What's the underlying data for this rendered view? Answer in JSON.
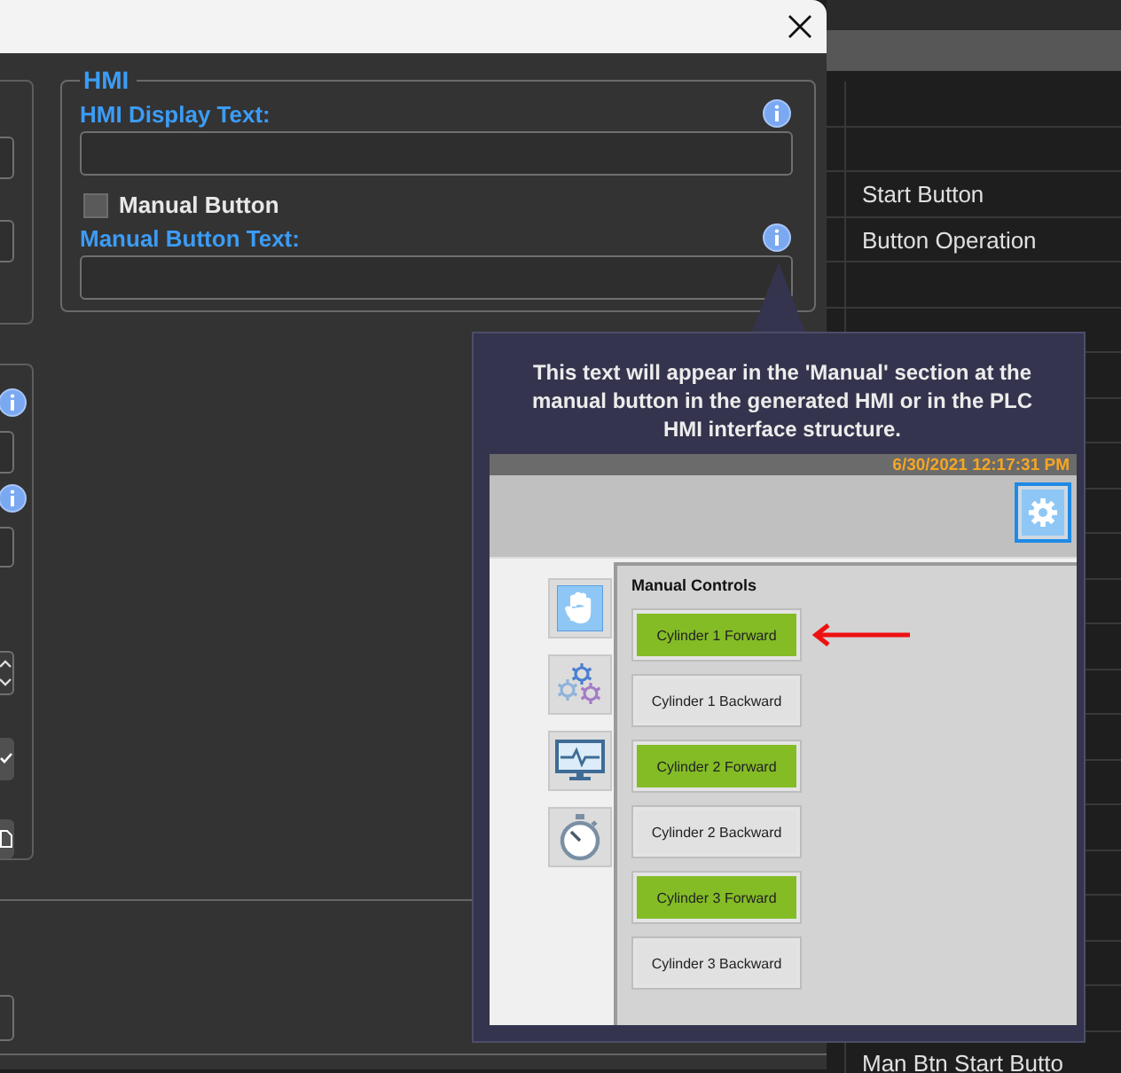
{
  "background_list": {
    "rows": [
      "Start Button",
      "Button Operation"
    ],
    "last_row": "Man Btn Start Butto"
  },
  "hmi_group": {
    "title": "HMI",
    "display_text": {
      "label": "HMI Display Text:"
    },
    "manual_button": {
      "label": "Manual Button",
      "checked": false
    },
    "manual_button_text": {
      "label": "Manual Button Text:"
    }
  },
  "tooltip": {
    "text": "This text will appear in the 'Manual' section at the manual button in the generated HMI or in the PLC HMI interface structure.",
    "preview": {
      "timestamp": "6/30/2021 12:17:31 PM",
      "panel_title": "Manual Controls",
      "buttons": [
        {
          "label": "Cylinder 1 Forward",
          "color": "#84bc26",
          "highlighted": true
        },
        {
          "label": "Cylinder 1 Backward",
          "color": "#e1e1e1",
          "highlighted": false
        },
        {
          "label": "Cylinder 2 Forward",
          "color": "#84bc26",
          "highlighted": false
        },
        {
          "label": "Cylinder 2 Backward",
          "color": "#e1e1e1",
          "highlighted": false
        },
        {
          "label": "Cylinder 3 Forward",
          "color": "#84bc26",
          "highlighted": false
        },
        {
          "label": "Cylinder 3 Backward",
          "color": "#e1e1e1",
          "highlighted": false
        }
      ]
    }
  }
}
